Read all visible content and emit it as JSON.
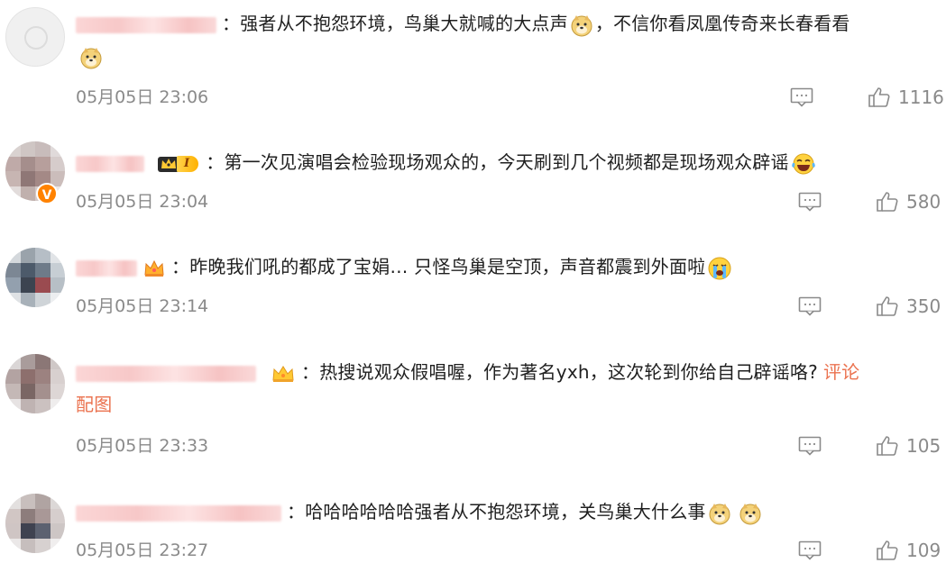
{
  "comments": [
    {
      "text": "强者从不抱怨环境，鸟巢大就喊的大点声",
      "text_after": "，不信你看凤凰传奇来长春看看",
      "colon": "：",
      "time": "05月05日 23:06",
      "likes": "1116",
      "badge": "none",
      "emojis": [
        "doge-emoji",
        "doge-emoji"
      ]
    },
    {
      "text": "第一次见演唱会检验现场观众的，今天刷到几个视频都是现场观众辟谣",
      "colon": "：",
      "time": "05月05日 23:04",
      "likes": "580",
      "badge": "crown-level-I",
      "badge_level": "I",
      "verified": "V",
      "emojis": [
        "laugh-cry-emoji"
      ]
    },
    {
      "text": "昨晚我们吼的都成了宝娟… 只怪鸟巢是空顶，声音都震到外面啦",
      "colon": "：",
      "time": "05月05日 23:14",
      "likes": "350",
      "badge": "small-crown",
      "emojis": [
        "crying-emoji"
      ]
    },
    {
      "text": "热搜说观众假唱喔，作为著名yxh，这次轮到你给自己辟谣咯?",
      "link": "评论配图",
      "link_part1": "评论",
      "link_part2": "配图",
      "colon": "：",
      "time": "05月05日 23:33",
      "likes": "105",
      "badge": "small-crown"
    },
    {
      "text": "哈哈哈哈哈哈强者从不抱怨环境，关鸟巢大什么事",
      "colon": "：",
      "time": "05月05日 23:27",
      "likes": "109",
      "badge": "none",
      "emojis": [
        "doge-emoji",
        "doge-emoji"
      ]
    }
  ],
  "colors": {
    "link": "#eb7350",
    "meta_gray": "#8a8a8a",
    "verified_orange": "#ff8200"
  }
}
